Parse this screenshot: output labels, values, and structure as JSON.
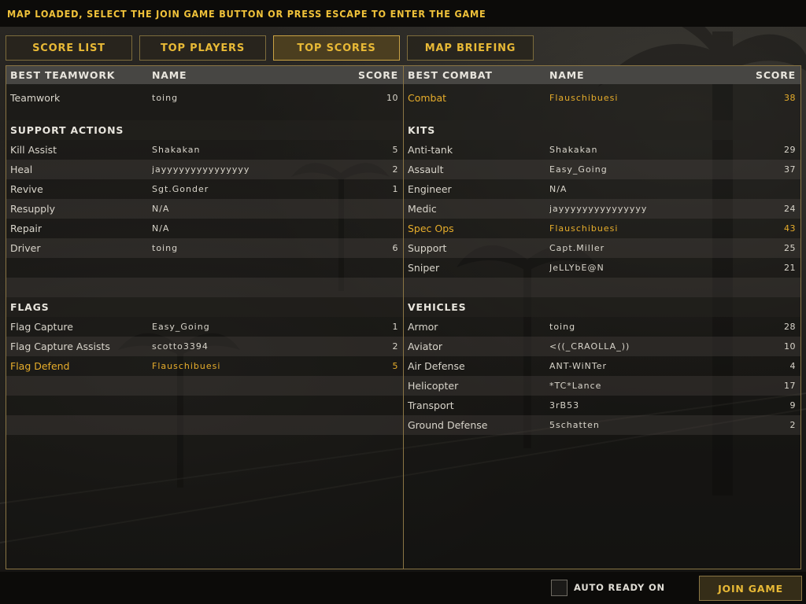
{
  "header": {
    "message": "MAP LOADED, SELECT THE JOIN GAME BUTTON OR PRESS ESCAPE TO ENTER THE GAME"
  },
  "tabs": [
    {
      "label": "SCORE LIST",
      "active": false
    },
    {
      "label": "TOP PLAYERS",
      "active": false
    },
    {
      "label": "TOP SCORES",
      "active": true
    },
    {
      "label": "MAP BRIEFING",
      "active": false
    }
  ],
  "colors": {
    "accent": "#e8b936",
    "highlight_row": "#e7ad2b",
    "panel_border": "#8a7544",
    "header_bg": "#474643"
  },
  "left": {
    "header": {
      "category": "BEST TEAMWORK",
      "name": "NAME",
      "score": "SCORE"
    },
    "top_rows": [
      {
        "label": "Teamwork",
        "name": "toing",
        "score": "10",
        "highlight": false
      }
    ],
    "sections": [
      {
        "title": "SUPPORT ACTIONS",
        "rows": [
          {
            "label": "Kill Assist",
            "name": "Shakakan",
            "score": "5",
            "highlight": false
          },
          {
            "label": "Heal",
            "name": "jayyyyyyyyyyyyyyy",
            "score": "2",
            "highlight": false
          },
          {
            "label": "Revive",
            "name": "Sgt.Gonder",
            "score": "1",
            "highlight": false
          },
          {
            "label": "Resupply",
            "name": "N/A",
            "score": "",
            "highlight": false
          },
          {
            "label": "Repair",
            "name": "N/A",
            "score": "",
            "highlight": false
          },
          {
            "label": "Driver",
            "name": "toing",
            "score": "6",
            "highlight": false
          },
          {
            "label": "",
            "name": "",
            "score": "",
            "highlight": false
          },
          {
            "label": "",
            "name": "",
            "score": "",
            "highlight": false
          }
        ]
      },
      {
        "title": "FLAGS",
        "rows": [
          {
            "label": "Flag Capture",
            "name": "Easy_Going",
            "score": "1",
            "highlight": false
          },
          {
            "label": "Flag Capture Assists",
            "name": "scotto3394",
            "score": "2",
            "highlight": false
          },
          {
            "label": "Flag Defend",
            "name": "Flauschibuesi",
            "score": "5",
            "highlight": true
          },
          {
            "label": "",
            "name": "",
            "score": "",
            "highlight": false
          },
          {
            "label": "",
            "name": "",
            "score": "",
            "highlight": false
          },
          {
            "label": "",
            "name": "",
            "score": "",
            "highlight": false
          }
        ]
      }
    ]
  },
  "right": {
    "header": {
      "category": "BEST COMBAT",
      "name": "NAME",
      "score": "SCORE"
    },
    "top_rows": [
      {
        "label": "Combat",
        "name": "Flauschibuesi",
        "score": "38",
        "highlight": true
      }
    ],
    "sections": [
      {
        "title": "KITS",
        "rows": [
          {
            "label": "Anti-tank",
            "name": "Shakakan",
            "score": "29",
            "highlight": false
          },
          {
            "label": "Assault",
            "name": "Easy_Going",
            "score": "37",
            "highlight": false
          },
          {
            "label": "Engineer",
            "name": "N/A",
            "score": "",
            "highlight": false
          },
          {
            "label": "Medic",
            "name": "jayyyyyyyyyyyyyyy",
            "score": "24",
            "highlight": false
          },
          {
            "label": "Spec Ops",
            "name": "Flauschibuesi",
            "score": "43",
            "highlight": true
          },
          {
            "label": "Support",
            "name": "Capt.Miller",
            "score": "25",
            "highlight": false
          },
          {
            "label": "Sniper",
            "name": "JeLLYbE@N",
            "score": "21",
            "highlight": false
          },
          {
            "label": "",
            "name": "",
            "score": "",
            "highlight": false
          }
        ]
      },
      {
        "title": "VEHICLES",
        "rows": [
          {
            "label": "Armor",
            "name": "toing",
            "score": "28",
            "highlight": false
          },
          {
            "label": "Aviator",
            "name": "<((_CRAOLLA_))",
            "score": "10",
            "highlight": false
          },
          {
            "label": "Air Defense",
            "name": "ANT-WiNTer",
            "score": "4",
            "highlight": false
          },
          {
            "label": "Helicopter",
            "name": "*TC*Lance",
            "score": "17",
            "highlight": false
          },
          {
            "label": "Transport",
            "name": "3rB53",
            "score": "9",
            "highlight": false
          },
          {
            "label": "Ground Defense",
            "name": "5schatten",
            "score": "2",
            "highlight": false
          }
        ]
      }
    ]
  },
  "footer": {
    "auto_ready_label": "AUTO READY ON",
    "auto_ready_checked": false,
    "join_label": "JOIN GAME"
  }
}
